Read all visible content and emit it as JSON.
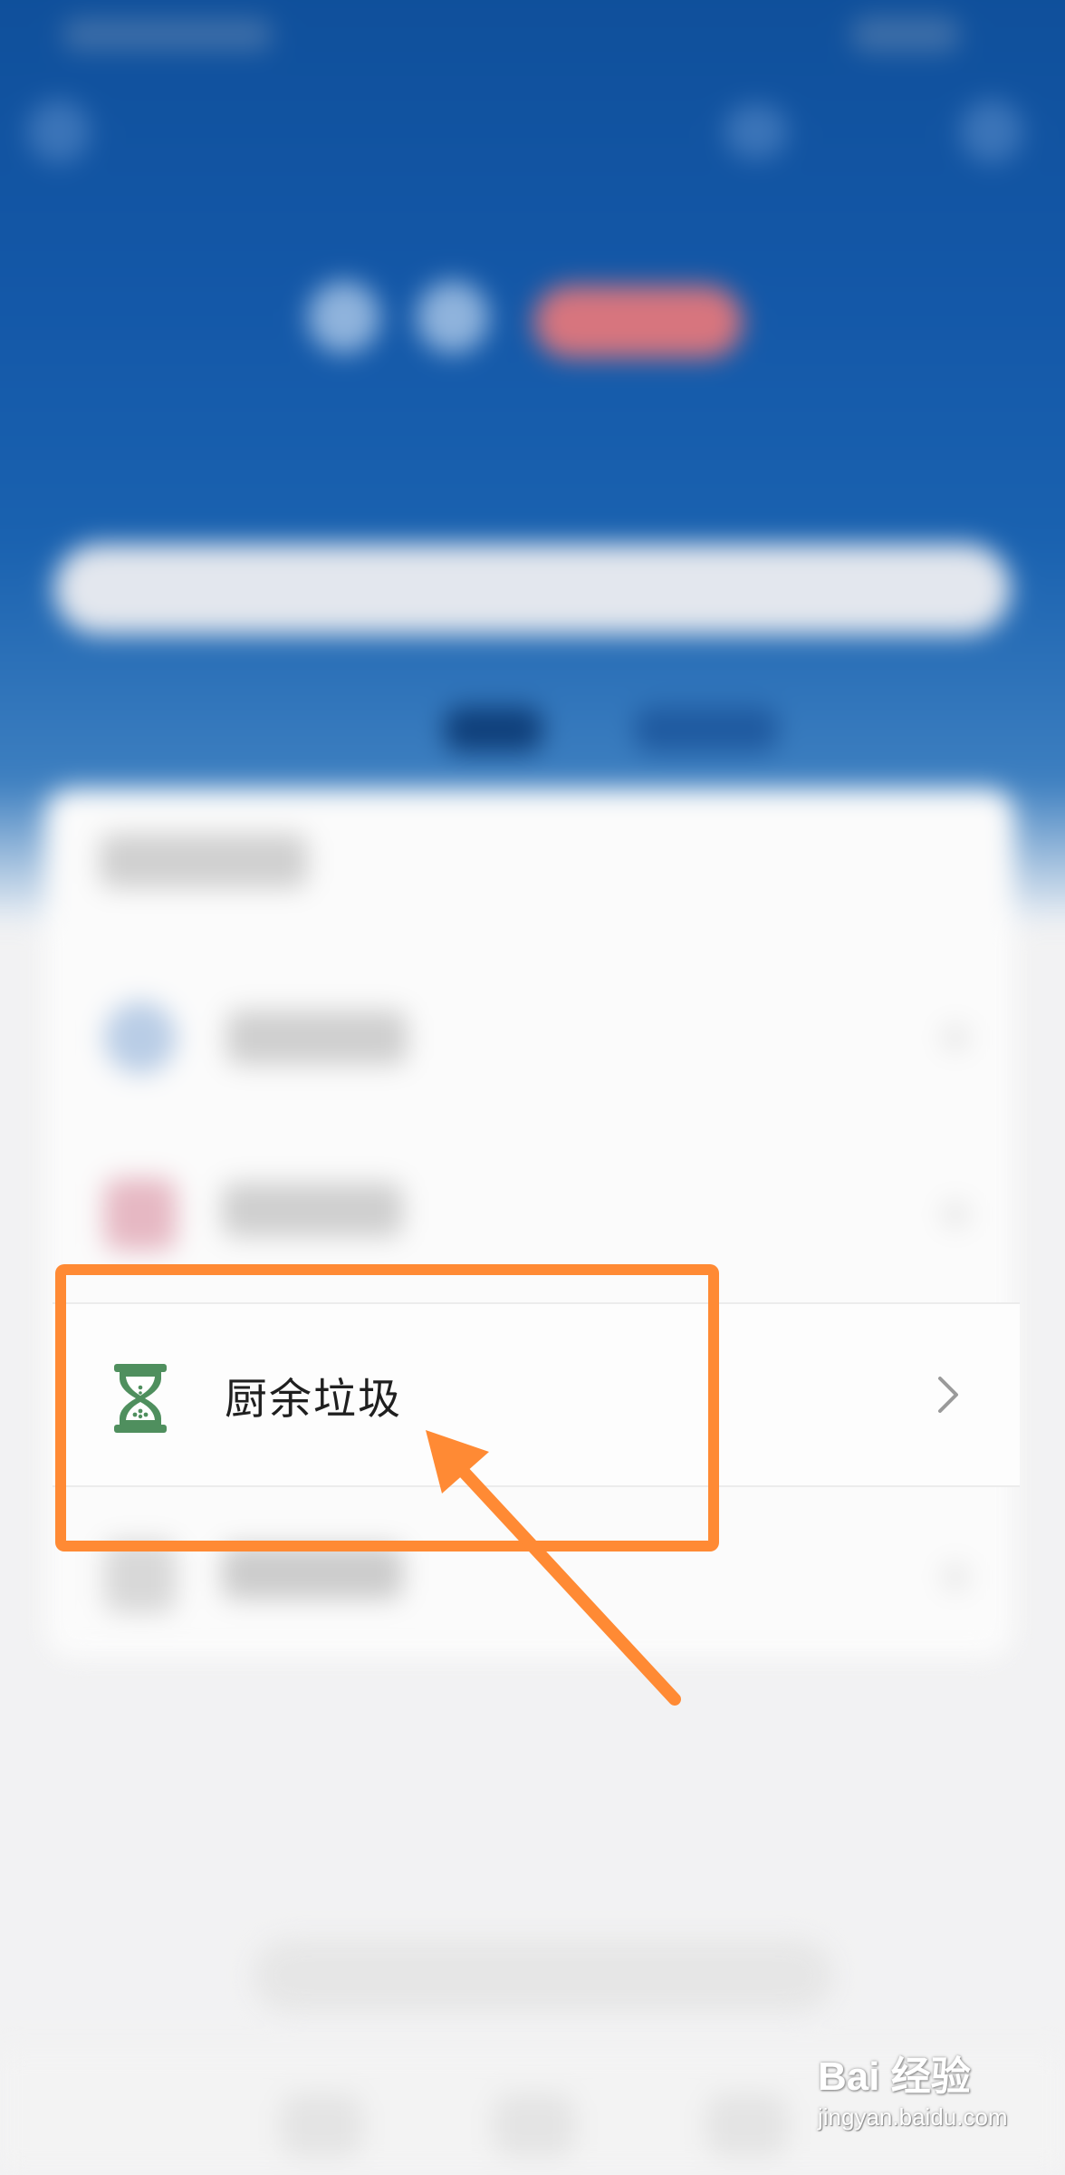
{
  "list": {
    "kitchen_waste": {
      "label": "厨余垃圾",
      "icon": "hourglass-icon",
      "icon_color": "#4f8f5e",
      "chevron": "chevron-right-icon"
    }
  },
  "annotation": {
    "highlight_color": "#ff8a34",
    "arrow_color": "#ff8a34"
  },
  "watermark": {
    "logo": "Bai 经验",
    "url": "jingyan.baidu.com"
  },
  "colors": {
    "header_blue": "#1458a8",
    "card_bg": "#fbfbfb",
    "page_bg": "#f2f2f3"
  }
}
